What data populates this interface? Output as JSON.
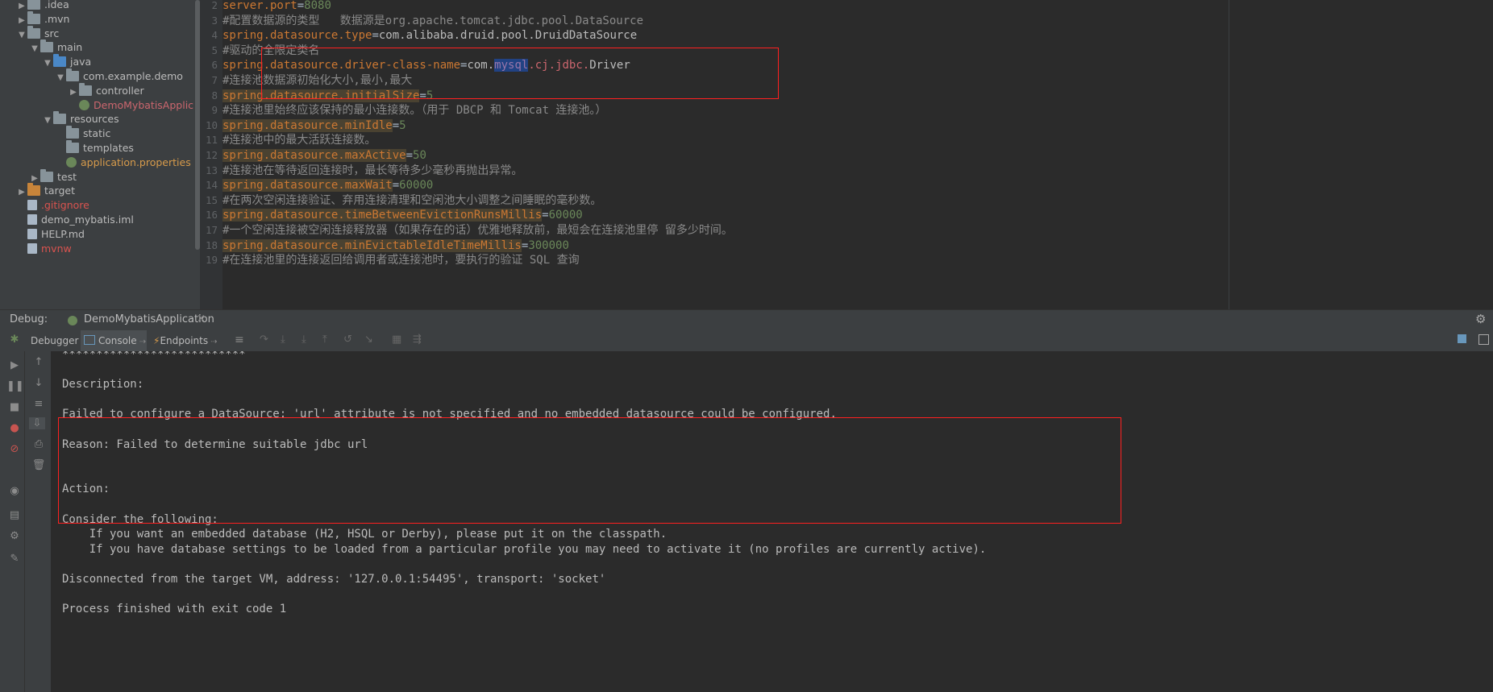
{
  "tree": {
    "items": [
      {
        "label": ".idea",
        "depth": 1,
        "arrow": "▶",
        "icon": "folder"
      },
      {
        "label": ".mvn",
        "depth": 1,
        "arrow": "▶",
        "icon": "folder"
      },
      {
        "label": "src",
        "depth": 1,
        "arrow": "▼",
        "icon": "folder"
      },
      {
        "label": "main",
        "depth": 2,
        "arrow": "▼",
        "icon": "folder"
      },
      {
        "label": "java",
        "depth": 3,
        "arrow": "▼",
        "icon": "folder-blue"
      },
      {
        "label": "com.example.demo",
        "depth": 4,
        "arrow": "▼",
        "icon": "folder"
      },
      {
        "label": "controller",
        "depth": 5,
        "arrow": "▶",
        "icon": "folder"
      },
      {
        "label": "DemoMybatisApplic",
        "depth": 5,
        "arrow": "",
        "icon": "spring-class"
      },
      {
        "label": "resources",
        "depth": 3,
        "arrow": "▼",
        "icon": "folder"
      },
      {
        "label": "static",
        "depth": 4,
        "arrow": "",
        "icon": "folder"
      },
      {
        "label": "templates",
        "depth": 4,
        "arrow": "",
        "icon": "folder"
      },
      {
        "label": "application.properties",
        "depth": 4,
        "arrow": "",
        "icon": "spring-file"
      },
      {
        "label": "test",
        "depth": 2,
        "arrow": "▶",
        "icon": "folder"
      },
      {
        "label": "target",
        "depth": 1,
        "arrow": "▶",
        "icon": "folder-orange"
      },
      {
        "label": ".gitignore",
        "depth": 1,
        "arrow": "",
        "icon": "file"
      },
      {
        "label": "demo_mybatis.iml",
        "depth": 1,
        "arrow": "",
        "icon": "file"
      },
      {
        "label": "HELP.md",
        "depth": 1,
        "arrow": "",
        "icon": "file"
      },
      {
        "label": "mvnw",
        "depth": 1,
        "arrow": "",
        "icon": "file"
      }
    ]
  },
  "editor": {
    "line_numbers": [
      "2",
      "3",
      "4",
      "5",
      "6",
      "7",
      "8",
      "9",
      "10",
      "11",
      "12",
      "13",
      "14",
      "15",
      "16",
      "17",
      "18",
      "19"
    ],
    "lines": [
      [
        {
          "t": "server.port",
          "c": "key"
        },
        {
          "t": "=",
          "c": "plain"
        },
        {
          "t": "8080",
          "c": "val"
        }
      ],
      [
        {
          "t": "#配置数据源的类型   数据源是org.apache.tomcat.jdbc.pool.DataSource",
          "c": "cm"
        }
      ],
      [
        {
          "t": "spring.datasource.type",
          "c": "key"
        },
        {
          "t": "=",
          "c": "plain"
        },
        {
          "t": "com.alibaba.druid.pool.DruidDataSource",
          "c": "str"
        }
      ],
      [
        {
          "t": "#驱动的全限定类名",
          "c": "cm"
        }
      ],
      [
        {
          "t": "spring.datasource.driver-class-name",
          "c": "key"
        },
        {
          "t": "=",
          "c": "plain"
        },
        {
          "t": "com.",
          "c": "str"
        },
        {
          "t": "mysql",
          "c": "sel"
        },
        {
          "t": ".cj.jdbc.",
          "c": "red"
        },
        {
          "t": "Driver",
          "c": "str"
        }
      ],
      [
        {
          "t": "#连接池数据源初始化大小,最小,最大",
          "c": "cm"
        }
      ],
      [
        {
          "t": "spring.datasource.initialSize",
          "c": "keyhl"
        },
        {
          "t": "=",
          "c": "plain"
        },
        {
          "t": "5",
          "c": "val"
        }
      ],
      [
        {
          "t": "#连接池里始终应该保持的最小连接数。（用于 DBCP 和 Tomcat 连接池。）",
          "c": "cm"
        }
      ],
      [
        {
          "t": "spring.datasource.minIdle",
          "c": "keyhl"
        },
        {
          "t": "=",
          "c": "plain"
        },
        {
          "t": "5",
          "c": "val"
        }
      ],
      [
        {
          "t": "#连接池中的最大活跃连接数。",
          "c": "cm"
        }
      ],
      [
        {
          "t": "spring.datasource.maxActive",
          "c": "keyhl"
        },
        {
          "t": "=",
          "c": "plain"
        },
        {
          "t": "50",
          "c": "val"
        }
      ],
      [
        {
          "t": "#连接池在等待返回连接时，最长等待多少毫秒再抛出异常。",
          "c": "cm"
        }
      ],
      [
        {
          "t": "spring.datasource.maxWait",
          "c": "keyhl"
        },
        {
          "t": "=",
          "c": "plain"
        },
        {
          "t": "60000",
          "c": "val"
        }
      ],
      [
        {
          "t": "#在两次空闲连接验证、弃用连接清理和空闲池大小调整之间睡眠的毫秒数。",
          "c": "cm"
        }
      ],
      [
        {
          "t": "spring.datasource.timeBetweenEvictionRunsMillis",
          "c": "keyhl"
        },
        {
          "t": "=",
          "c": "plain"
        },
        {
          "t": "60000",
          "c": "val"
        }
      ],
      [
        {
          "t": "#一个空闲连接被空闲连接释放器（如果存在的话）优雅地释放前，最短会在连接池里停 留多少时间。",
          "c": "cm"
        }
      ],
      [
        {
          "t": "spring.datasource.minEvictableIdleTimeMillis",
          "c": "keyhl"
        },
        {
          "t": "=",
          "c": "plain"
        },
        {
          "t": "300000",
          "c": "val"
        }
      ],
      [
        {
          "t": "#在连接池里的连接返回给调用者或连接池时，要执行的验证 SQL 查询",
          "c": "cm"
        }
      ]
    ]
  },
  "debug": {
    "label": "Debug:",
    "run_config": "DemoMybatisApplication",
    "tabs": {
      "debugger": "Debugger",
      "console": "Console",
      "endpoints": "Endpoints"
    }
  },
  "console": {
    "lines": [
      "***************************",
      "",
      "Description:",
      "",
      "Failed to configure a DataSource: 'url' attribute is not specified and no embedded datasource could be configured.",
      "",
      "Reason: Failed to determine suitable jdbc url",
      "",
      "",
      "Action:",
      "",
      "Consider the following:",
      "    If you want an embedded database (H2, HSQL or Derby), please put it on the classpath.",
      "    If you have database settings to be loaded from a particular profile you may need to activate it (no profiles are currently active).",
      "",
      "Disconnected from the target VM, address: '127.0.0.1:54495', transport: 'socket'",
      "",
      "Process finished with exit code 1"
    ]
  },
  "colors": {
    "accent_red_box": "#ff2020",
    "selection": "#214283"
  }
}
